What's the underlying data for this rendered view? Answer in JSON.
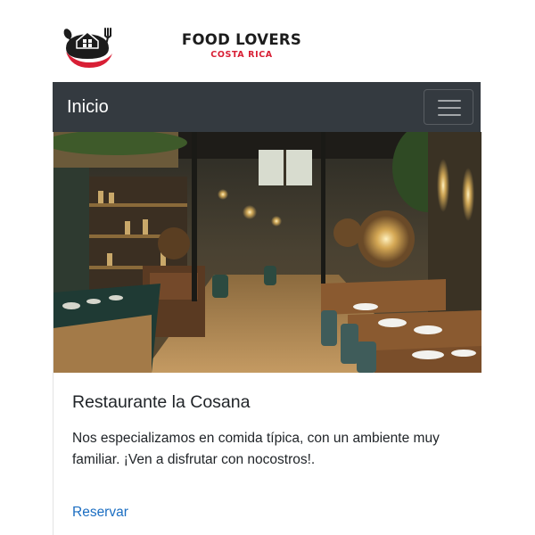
{
  "header": {
    "logo_icon": "house-fork-spoon-icon",
    "logo_title": "FOOD LOVERS",
    "logo_subtitle": "COSTA RICA",
    "colors": {
      "brand_red": "#d81f35",
      "brand_dark": "#1c1c1c"
    }
  },
  "navbar": {
    "brand_label": "Inicio",
    "toggler_icon": "hamburger-menu-icon",
    "colors": {
      "background": "#343a40",
      "text": "#ffffff"
    }
  },
  "card": {
    "image_subject": "restaurant-interior-photo",
    "title": "Restaurante la Cosana",
    "text": "Nos especializamos en comida típica, con un ambiente muy familiar. ¡Ven a disfrutar con nocostros!.",
    "link_label": "Reservar",
    "colors": {
      "link": "#1b6ec2"
    }
  }
}
